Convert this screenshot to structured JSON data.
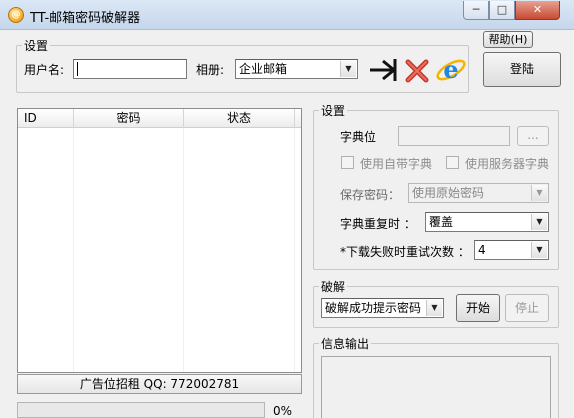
{
  "window": {
    "title": "TT-邮箱密码破解器",
    "app_icon_glyph": "@"
  },
  "title_buttons": {
    "minimize": "─",
    "maximize": "□",
    "close": "✕"
  },
  "login": {
    "group_title": "设置",
    "username_label": "用户名:",
    "username_value": "",
    "album_label": "相册:",
    "album_value": "企业邮箱"
  },
  "actions": {
    "help_label": "帮助(H)",
    "login_label": "登陆",
    "icons": [
      "arrow-right-icon",
      "red-x-icon",
      "ie-browser-icon"
    ]
  },
  "list": {
    "columns": [
      "ID",
      "密码",
      "状态"
    ],
    "rows": []
  },
  "settings": {
    "group_title": "设置",
    "dict_label": "字典位",
    "dict_value": "",
    "browse_label": "...",
    "use_builtin_dict": "使用自带字典",
    "use_server_dict": "使用服务器字典",
    "save_password_label": "保存密码：",
    "save_password_value": "使用原始密码",
    "dict_repeat_label": "字典重复时 ：",
    "dict_repeat_value": "覆盖",
    "retry_label": "*下载失败时重试次数 ：",
    "retry_value": "4"
  },
  "crack": {
    "group_title": "破解",
    "mode_value": "破解成功提示密码",
    "start_label": "开始",
    "stop_label": "停止"
  },
  "output": {
    "group_title": "信息输出"
  },
  "status": {
    "ad_text": "广告位招租   QQ: 772002781"
  },
  "progress": {
    "value": 0,
    "percent_text": "0%"
  },
  "colors": {
    "progress_fill": "#3fb13f",
    "close_red": "#c74a33",
    "ie_blue": "#1e88e5"
  }
}
